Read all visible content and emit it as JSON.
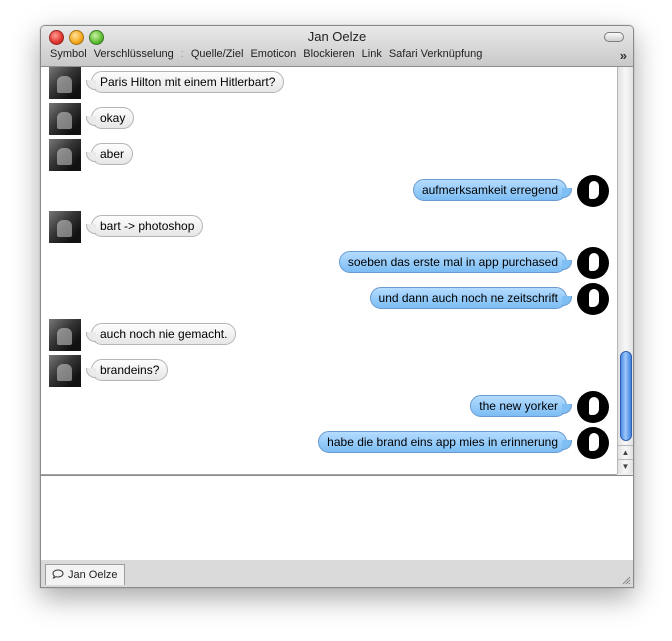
{
  "window": {
    "title": "Jan Oelze"
  },
  "toolbar": {
    "items": [
      "Symbol",
      "Verschlüsselung",
      "Quelle/Ziel",
      "Emoticon",
      "Blockieren",
      "Link",
      "Safari Verknüpfung"
    ],
    "overflow_label": "»"
  },
  "messages": [
    {
      "from": "buddy",
      "text": "Paris Hilton mit einem Hitlerbart?"
    },
    {
      "from": "buddy",
      "text": "okay"
    },
    {
      "from": "buddy",
      "text": "aber"
    },
    {
      "from": "self",
      "text": "aufmerksamkeit erregend"
    },
    {
      "from": "buddy",
      "text": "bart -> photoshop"
    },
    {
      "from": "self",
      "text": "soeben das erste mal in app purchased"
    },
    {
      "from": "self",
      "text": "und dann auch noch ne zeitschrift"
    },
    {
      "from": "buddy",
      "text": "auch noch nie gemacht."
    },
    {
      "from": "buddy",
      "text": "brandeins?"
    },
    {
      "from": "self",
      "text": "the new yorker"
    },
    {
      "from": "self",
      "text": "habe die brand eins app mies in erinnerung"
    }
  ],
  "input": {
    "value": ""
  },
  "tabs": [
    {
      "label": "Jan Oelze",
      "icon": "speech-bubble-icon"
    }
  ],
  "colors": {
    "self_bubble": "#8ec7f7",
    "buddy_bubble": "#efefef",
    "scroll_thumb": "#4a8be8"
  }
}
